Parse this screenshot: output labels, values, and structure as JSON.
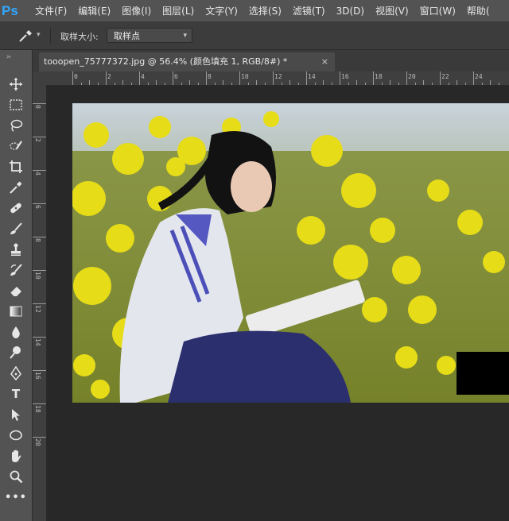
{
  "app": {
    "logo": "Ps"
  },
  "menu": {
    "items": [
      "文件(F)",
      "编辑(E)",
      "图像(I)",
      "图层(L)",
      "文字(Y)",
      "选择(S)",
      "滤镜(T)",
      "3D(D)",
      "视图(V)",
      "窗口(W)",
      "帮助("
    ]
  },
  "options": {
    "tool_icon": "eyedropper-icon",
    "sample_size_label": "取样大小:",
    "sample_size_value": "取样点"
  },
  "document": {
    "tab_title": "tooopen_75777372.jpg @ 56.4% (颜色填充 1, RGB/8#) *",
    "close_glyph": "×"
  },
  "ruler": {
    "top_labels": [
      "0",
      "2",
      "4",
      "6",
      "8",
      "10",
      "12",
      "14",
      "16",
      "18",
      "20",
      "22",
      "24"
    ],
    "left_labels": [
      "0",
      "2",
      "4",
      "6",
      "8",
      "1\n0",
      "1\n2",
      "1\n4",
      "1\n6",
      "1\n8",
      "2\n0"
    ]
  },
  "tools": [
    "move-tool-icon",
    "marquee-tool-icon",
    "lasso-tool-icon",
    "quick-select-tool-icon",
    "crop-tool-icon",
    "eyedropper-tool-icon",
    "healing-brush-tool-icon",
    "brush-tool-icon",
    "clone-stamp-tool-icon",
    "history-brush-tool-icon",
    "eraser-tool-icon",
    "gradient-tool-icon",
    "blur-tool-icon",
    "dodge-tool-icon",
    "pen-tool-icon",
    "type-tool-icon",
    "path-select-tool-icon",
    "ellipse-tool-icon",
    "hand-tool-icon",
    "zoom-tool-icon",
    "more-tools-icon"
  ],
  "type_tool_glyph": "T",
  "colors": {
    "accent": "#31a8ff",
    "swatch_dark": "#000000",
    "swatch_light": "#d8dde6"
  }
}
